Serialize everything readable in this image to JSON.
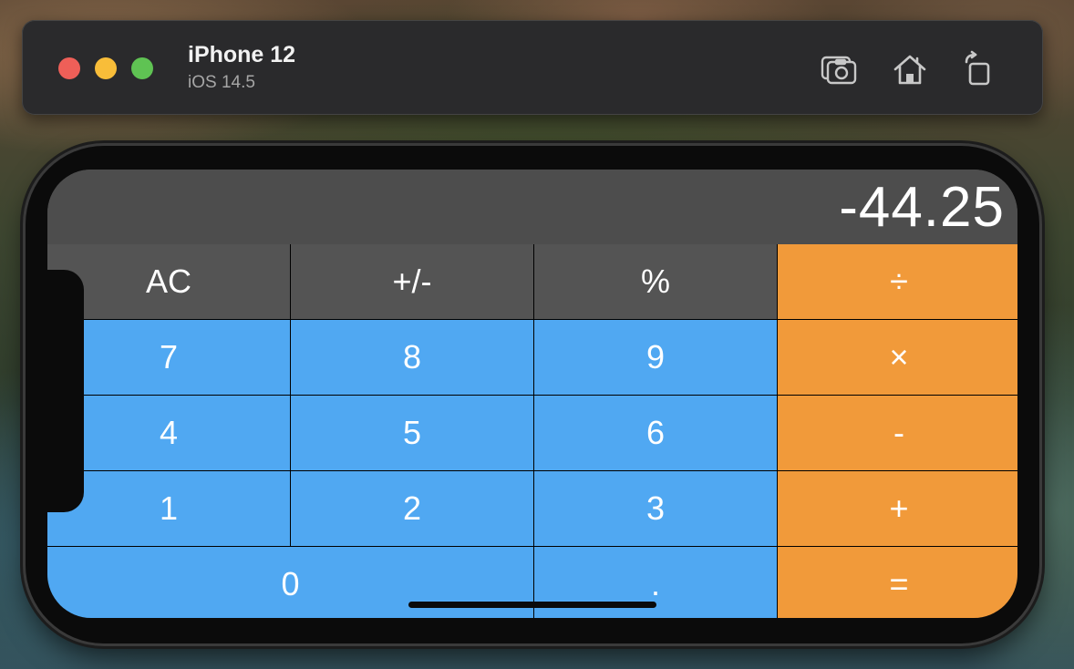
{
  "simulator": {
    "title": "iPhone 12",
    "subtitle": "iOS 14.5",
    "toolbar": [
      "screenshot-icon",
      "home-icon",
      "rotate-icon"
    ]
  },
  "calculator": {
    "display": "-44.25",
    "keys": [
      {
        "label": "AC",
        "style": "gray"
      },
      {
        "label": "+/-",
        "style": "gray"
      },
      {
        "label": "%",
        "style": "gray"
      },
      {
        "label": "÷",
        "style": "orange"
      },
      {
        "label": "7",
        "style": "blue"
      },
      {
        "label": "8",
        "style": "blue"
      },
      {
        "label": "9",
        "style": "blue"
      },
      {
        "label": "×",
        "style": "orange"
      },
      {
        "label": "4",
        "style": "blue"
      },
      {
        "label": "5",
        "style": "blue"
      },
      {
        "label": "6",
        "style": "blue"
      },
      {
        "label": "-",
        "style": "orange"
      },
      {
        "label": "1",
        "style": "blue"
      },
      {
        "label": "2",
        "style": "blue"
      },
      {
        "label": "3",
        "style": "blue"
      },
      {
        "label": "+",
        "style": "orange"
      },
      {
        "label": "0",
        "style": "blue"
      },
      {
        "label": ".",
        "style": "blue"
      },
      {
        "label": "=",
        "style": "orange"
      }
    ]
  },
  "colors": {
    "gray_key": "#545454",
    "blue_key": "#50a8f2",
    "orange_key": "#f19a3a",
    "display_bg": "#4d4d4d"
  }
}
